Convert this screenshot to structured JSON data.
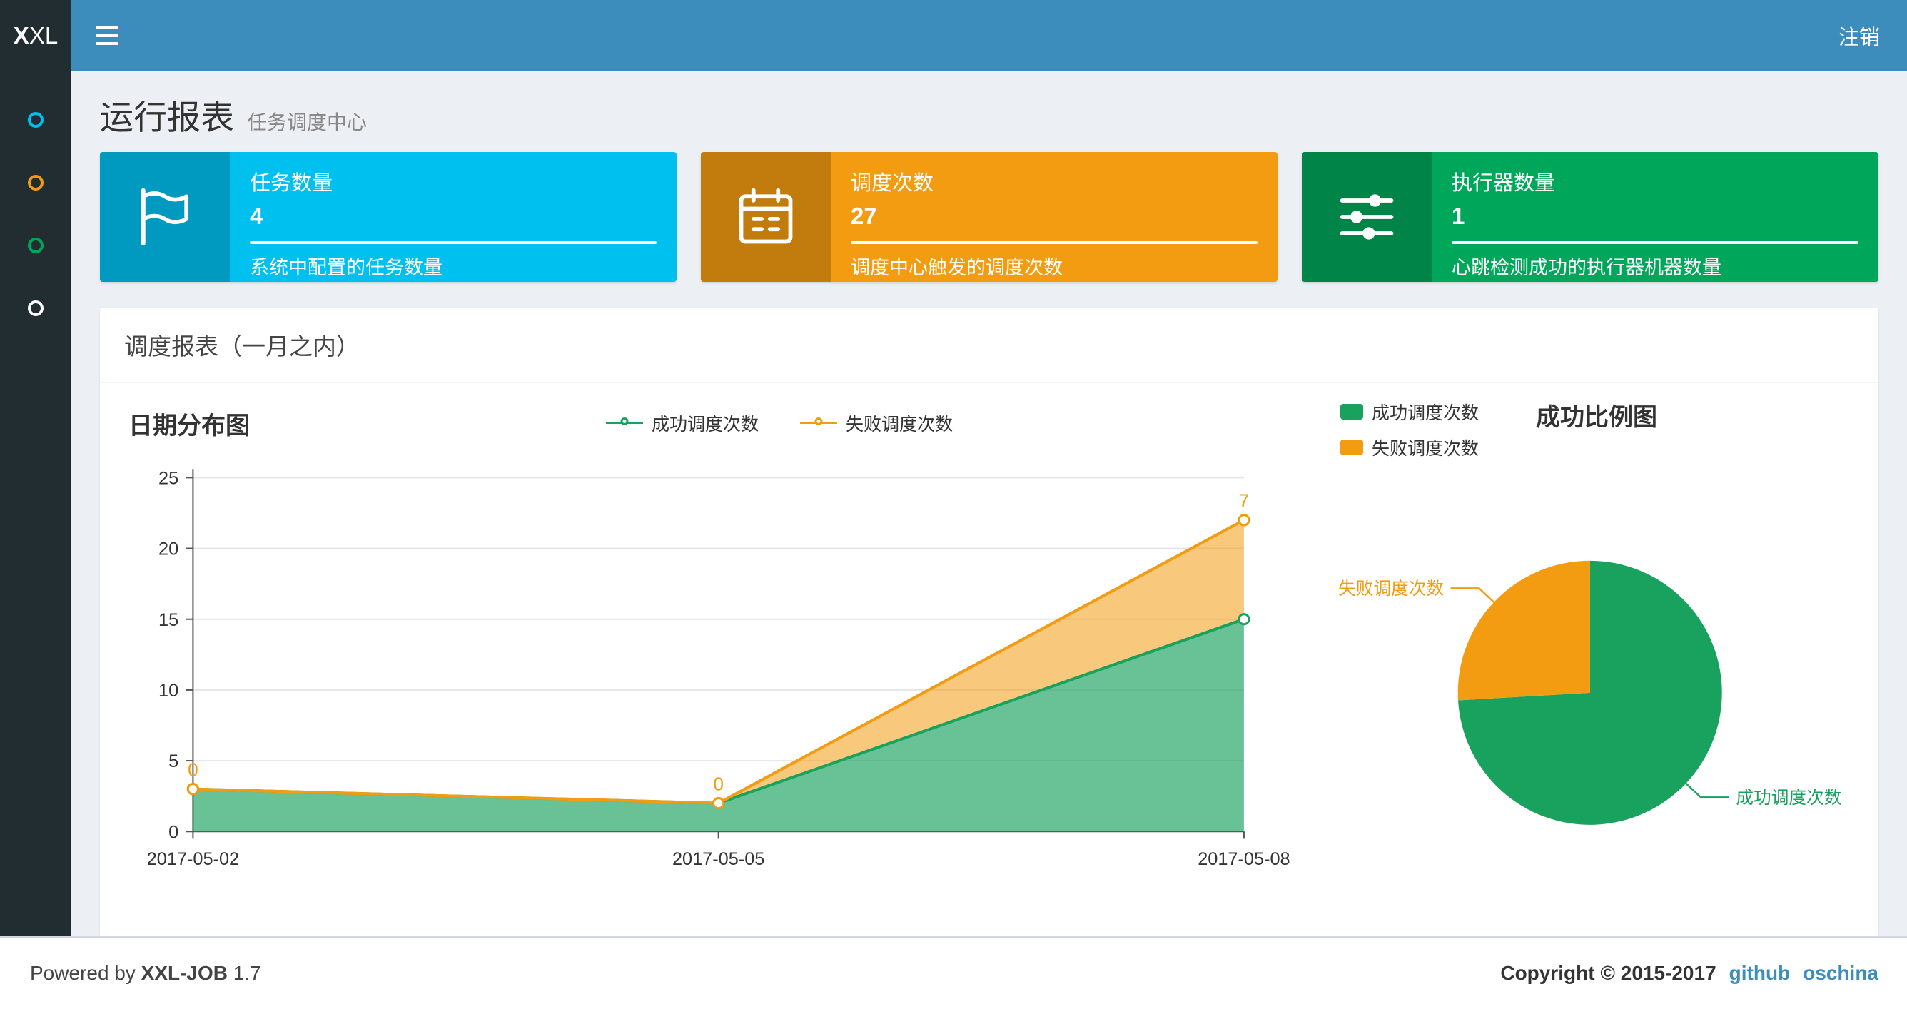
{
  "navbar": {
    "logo_bold": "X",
    "logo_rest": "XL",
    "logout": "注销"
  },
  "sidebar": {
    "items": [
      {
        "name": "sidebar-item-1",
        "color": "#00c0ef"
      },
      {
        "name": "sidebar-item-2",
        "color": "#f39c12"
      },
      {
        "name": "sidebar-item-3",
        "color": "#00a65a"
      },
      {
        "name": "sidebar-item-4",
        "color": "#ffffff"
      }
    ]
  },
  "page": {
    "title": "运行报表",
    "subtitle": "任务调度中心"
  },
  "info_boxes": [
    {
      "title": "任务数量",
      "value": "4",
      "desc": "系统中配置的任务数量",
      "bg": "#00c0ef",
      "icon": "flag-icon"
    },
    {
      "title": "调度次数",
      "value": "27",
      "desc": "调度中心触发的调度次数",
      "bg": "#f39c12",
      "icon": "calendar-icon"
    },
    {
      "title": "执行器数量",
      "value": "1",
      "desc": "心跳检测成功的执行器机器数量",
      "bg": "#00a65a",
      "icon": "sliders-icon"
    }
  ],
  "panel": {
    "title": "调度报表（一月之内）"
  },
  "chart_data": [
    {
      "type": "area",
      "title": "日期分布图",
      "stacked": true,
      "x": [
        "2017-05-02",
        "2017-05-05",
        "2017-05-08"
      ],
      "ylim": [
        0,
        25
      ],
      "yticks": [
        0,
        5,
        10,
        15,
        20,
        25
      ],
      "grid": true,
      "legend_position": "top-center",
      "series": [
        {
          "name": "成功调度次数",
          "values": [
            3,
            2,
            15
          ],
          "color": "#19a15e"
        },
        {
          "name": "失败调度次数",
          "values": [
            0,
            0,
            7
          ],
          "color": "#f39c12",
          "point_labels": [
            "0",
            "0",
            "7"
          ]
        }
      ]
    },
    {
      "type": "pie",
      "title": "成功比例图",
      "legend_position": "top-left",
      "slices": [
        {
          "label": "成功调度次数",
          "value": 20,
          "color": "#19a15e"
        },
        {
          "label": "失败调度次数",
          "value": 7,
          "color": "#f39c12"
        }
      ]
    }
  ],
  "footer": {
    "powered_prefix": "Powered by",
    "brand": "XXL-JOB",
    "version": "1.7",
    "copyright": "Copyright © 2015-2017",
    "links": [
      {
        "label": "github"
      },
      {
        "label": "oschina"
      }
    ]
  }
}
